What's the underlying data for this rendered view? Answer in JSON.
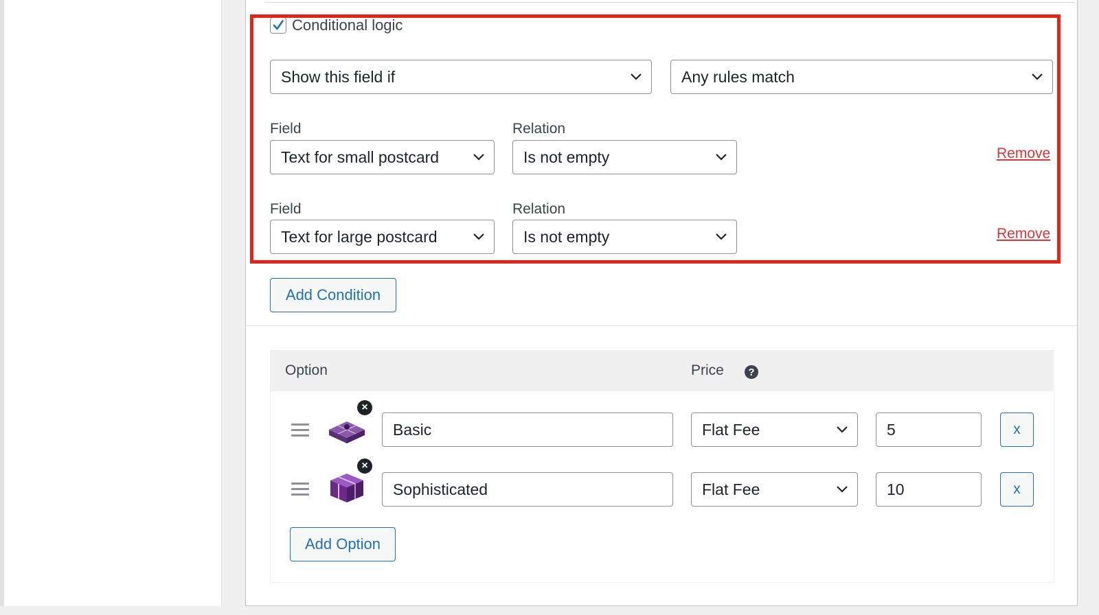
{
  "conditional_logic": {
    "checkbox_label": "Conditional logic",
    "checked": true,
    "action_select": "Show this field if",
    "match_select": "Any rules match",
    "rules": [
      {
        "field_label": "Field",
        "field_value": "Text for small postcard",
        "relation_label": "Relation",
        "relation_value": "Is not empty",
        "remove_label": "Remove"
      },
      {
        "field_label": "Field",
        "field_value": "Text for large postcard",
        "relation_label": "Relation",
        "relation_value": "Is not empty",
        "remove_label": "Remove"
      }
    ],
    "add_condition_label": "Add Condition"
  },
  "options": {
    "header_option": "Option",
    "header_price": "Price",
    "help_glyph": "?",
    "rows": [
      {
        "name": "Basic",
        "price_type": "Flat Fee",
        "price": "5",
        "remove_label": "x",
        "thumb_remove_glyph": "×",
        "icon": "gift-box-flat-icon"
      },
      {
        "name": "Sophisticated",
        "price_type": "Flat Fee",
        "price": "10",
        "remove_label": "x",
        "thumb_remove_glyph": "×",
        "icon": "gift-box-purple-icon"
      }
    ],
    "add_option_label": "Add Option"
  },
  "colors": {
    "accent": "#2271b1",
    "highlight_border": "#e1251b",
    "remove_link": "#d63638",
    "gift_purple": "#6b2a8a"
  }
}
